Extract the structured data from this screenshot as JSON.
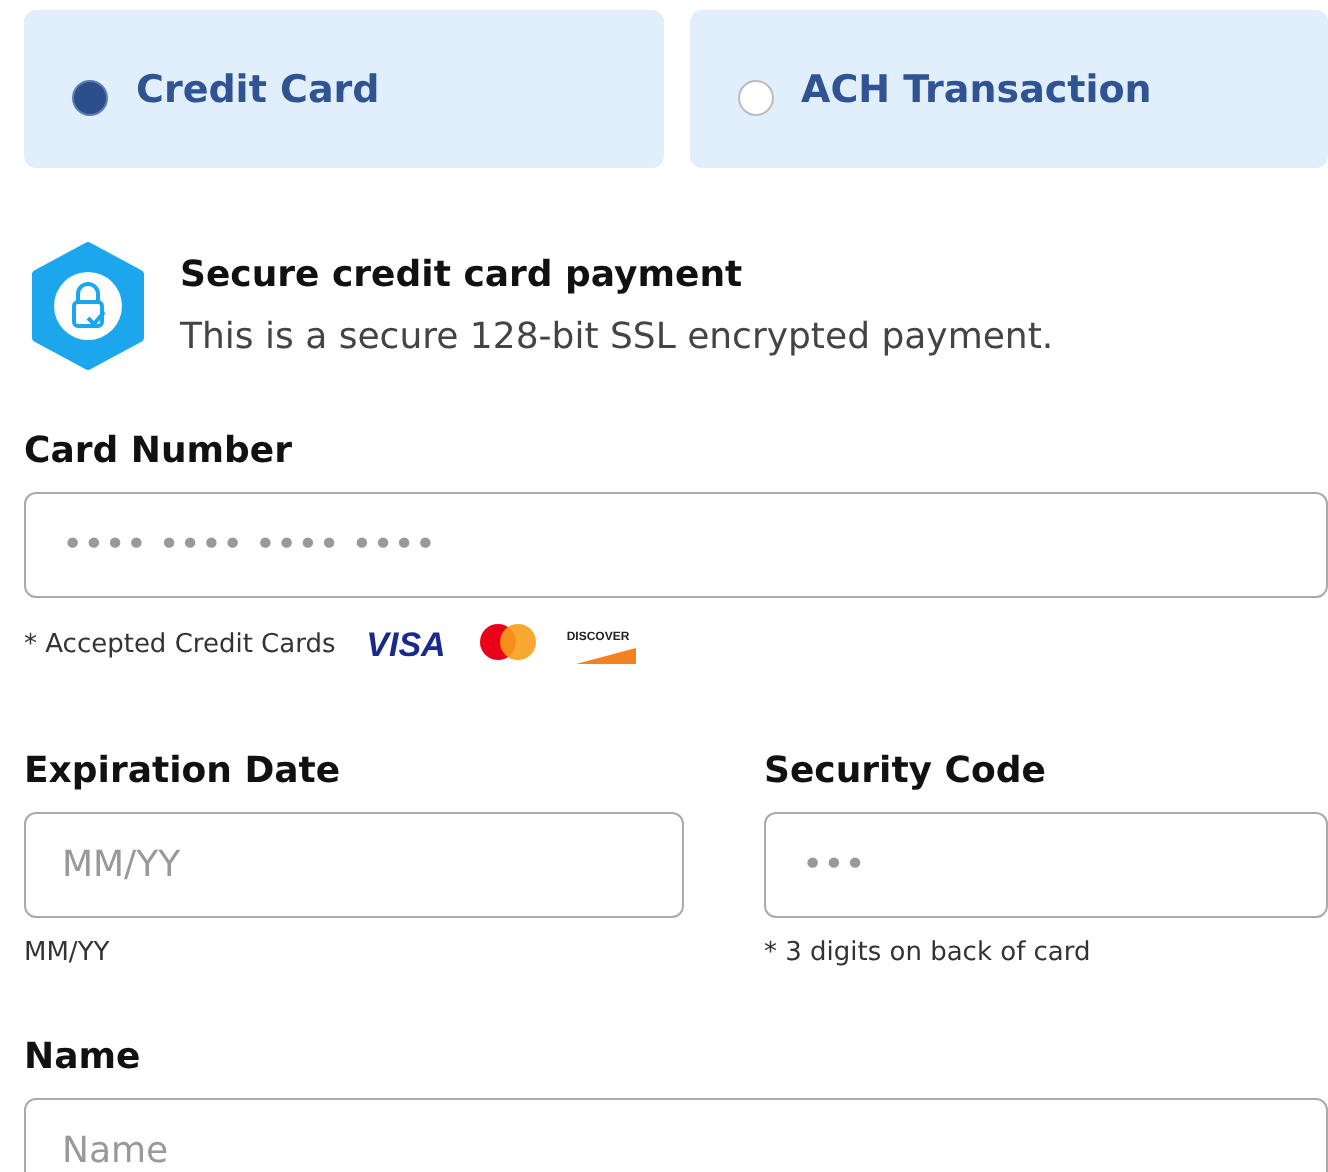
{
  "payment_methods": [
    {
      "label": "Credit Card",
      "selected": true
    },
    {
      "label": "ACH Transaction",
      "selected": false
    }
  ],
  "security_notice": {
    "title": "Secure credit card payment",
    "text": "This is a secure 128-bit SSL encrypted payment."
  },
  "card_number": {
    "label": "Card Number",
    "placeholder": "•••• •••• •••• ••••",
    "hint": "* Accepted Credit Cards",
    "card_logos": [
      {
        "kind": "visa",
        "text": "VISA"
      },
      {
        "kind": "mastercard"
      },
      {
        "kind": "discover",
        "text": "DISCOVER"
      }
    ]
  },
  "expiration_date": {
    "label": "Expiration Date",
    "placeholder": "MM/YY",
    "hint": "MM/YY"
  },
  "security_code": {
    "label": "Security Code",
    "placeholder": "•••",
    "hint": "* 3 digits on back of card"
  },
  "name": {
    "label": "Name",
    "placeholder": "Name"
  }
}
